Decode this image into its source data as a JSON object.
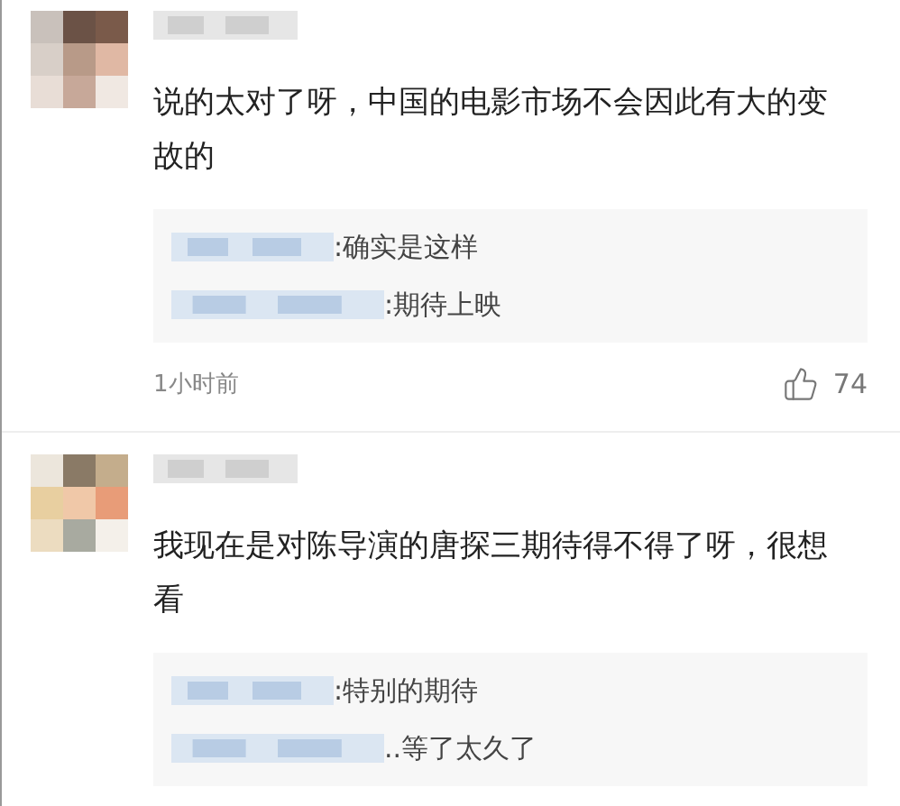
{
  "comments": [
    {
      "text": "说的太对了呀，中国的电影市场不会因此有大的变故的",
      "replies": [
        {
          "text": ":确实是这样"
        },
        {
          "text": ":期待上映"
        }
      ],
      "time": "1小时前",
      "likes": "74"
    },
    {
      "text": "我现在是对陈导演的唐探三期待得不得了呀，很想看",
      "replies": [
        {
          "text": ":特别的期待"
        },
        {
          "text": "..等了太久了"
        }
      ]
    }
  ]
}
